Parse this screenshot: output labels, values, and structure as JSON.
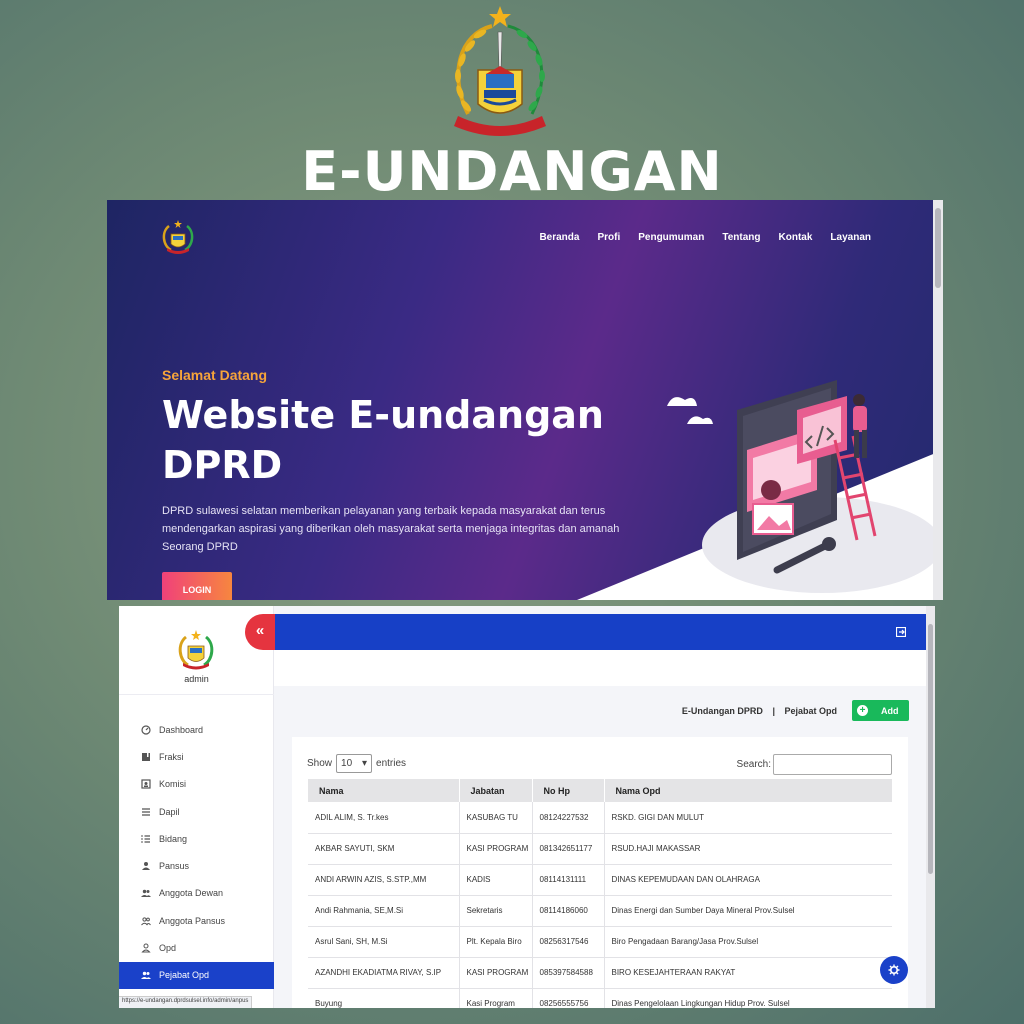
{
  "page": {
    "title": "E-UNDANGAN"
  },
  "hero": {
    "nav": [
      "Beranda",
      "Profi",
      "Pengumuman",
      "Tentang",
      "Kontak",
      "Layanan"
    ],
    "subtitle": "Selamat Datang",
    "title": "Website E-undangan DPRD",
    "description": "DPRD sulawesi selatan memberikan pelayanan yang terbaik kepada masyarakat dan terus mendengarkan aspirasi yang diberikan oleh masyarakat serta menjaga integritas dan amanah Seorang DPRD",
    "login_label": "LOGIN"
  },
  "admin": {
    "user": "admin",
    "collapse_icon": "«",
    "menu": [
      {
        "label": "Dashboard",
        "icon": "dashboard-icon"
      },
      {
        "label": "Fraksi",
        "icon": "book-icon"
      },
      {
        "label": "Komisi",
        "icon": "id-card-icon"
      },
      {
        "label": "Dapil",
        "icon": "list-icon"
      },
      {
        "label": "Bidang",
        "icon": "ordered-list-icon"
      },
      {
        "label": "Pansus",
        "icon": "user-icon"
      },
      {
        "label": "Anggota Dewan",
        "icon": "users-icon"
      },
      {
        "label": "Anggota Pansus",
        "icon": "users-outline-icon"
      },
      {
        "label": "Opd",
        "icon": "user-outline-icon"
      },
      {
        "label": "Pejabat Opd",
        "icon": "users-icon"
      }
    ],
    "active_menu": "Pejabat Opd",
    "breadcrumb": [
      "E-Undangan DPRD",
      "Pejabat Opd"
    ],
    "breadcrumb_sep": "|",
    "add_label": "Add",
    "show_label": "Show",
    "entries_value": "10",
    "entries_label": "entries",
    "search_label": "Search:",
    "table": {
      "columns": [
        "Nama",
        "Jabatan",
        "No Hp",
        "Nama Opd"
      ],
      "rows": [
        [
          "ADIL ALIM, S. Tr.kes",
          "KASUBAG TU",
          "08124227532",
          "RSKD. GIGI DAN MULUT"
        ],
        [
          "AKBAR SAYUTI, SKM",
          "KASI PROGRAM",
          "081342651177",
          "RSUD.HAJI MAKASSAR"
        ],
        [
          "ANDI ARWIN AZIS, S.STP.,MM",
          "KADIS",
          "08114131111",
          "DINAS KEPEMUDAAN DAN OLAHRAGA"
        ],
        [
          "Andi Rahmania, SE,M.Si",
          "Sekretaris",
          "08114186060",
          "Dinas Energi dan Sumber Daya Mineral Prov.Sulsel"
        ],
        [
          "Asrul Sani, SH, M.Si",
          "Plt. Kepala Biro",
          "08256317546",
          "Biro Pengadaan Barang/Jasa Prov.Sulsel"
        ],
        [
          "AZANDHI EKADIATMA RIVAY, S.IP",
          "KASI PROGRAM",
          "085397584588",
          "BIRO KESEJAHTERAAN RAKYAT"
        ],
        [
          "Buyung",
          "Kasi Program",
          "08256555756",
          "Dinas Pengelolaan Lingkungan Hidup Prov. Sulsel"
        ]
      ]
    },
    "status_url": "https://e-undangan.dprdsulsel.info/admin/anpus"
  },
  "colors": {
    "primary_blue": "#1740c6",
    "red": "#e5343f",
    "green": "#19b95b",
    "orange": "#f6a43a"
  }
}
